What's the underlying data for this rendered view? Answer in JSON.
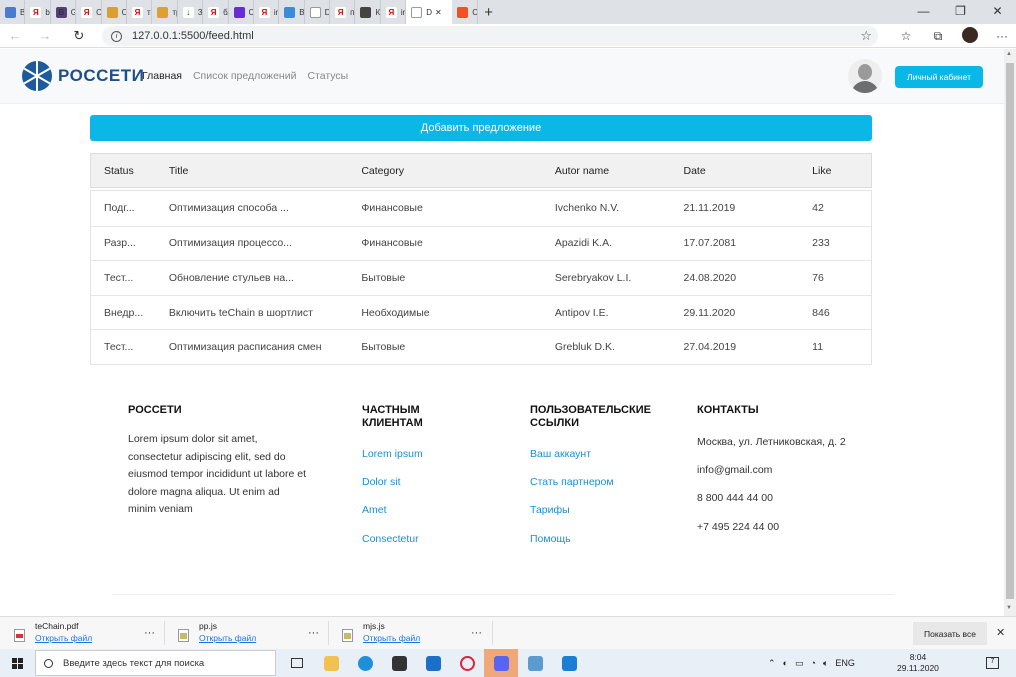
{
  "browser": {
    "tabs": [
      {
        "label": "Все п",
        "icon": "tab-page-icon",
        "color": "#4a7bd1",
        "glyph": ""
      },
      {
        "label": "boots",
        "icon": "yandex-icon",
        "color": "#ffffff",
        "glyph": "Я"
      },
      {
        "label": "Grid s",
        "icon": "bootstrap-icon",
        "color": "#563d7c",
        "glyph": "B"
      },
      {
        "label": "Опти",
        "icon": "yandex-icon",
        "color": "#ffffff",
        "glyph": "Я"
      },
      {
        "label": "Опти",
        "icon": "page-icon",
        "color": "#d9a030",
        "glyph": ""
      },
      {
        "label": "транс",
        "icon": "yandex-icon",
        "color": "#ffffff",
        "glyph": "Я"
      },
      {
        "label": "транс",
        "icon": "image-icon",
        "color": "#e0a030",
        "glyph": ""
      },
      {
        "label": "Загру",
        "icon": "download-icon",
        "color": "#ffffff",
        "glyph": "↓"
      },
      {
        "label": "блок",
        "icon": "yandex-icon",
        "color": "#ffffff",
        "glyph": "Я"
      },
      {
        "label": "Секц",
        "icon": "purple-icon",
        "color": "#6a2bd9",
        "glyph": ""
      },
      {
        "label": "image",
        "icon": "yandex-icon",
        "color": "#ffffff",
        "glyph": "Я"
      },
      {
        "label": "Выра",
        "icon": "color-icon",
        "color": "#3b8bd9",
        "glyph": ""
      },
      {
        "label": "Docu",
        "icon": "doc-icon",
        "color": "#ffffff",
        "glyph": ""
      },
      {
        "label": "подк",
        "icon": "yandex-icon",
        "color": "#ffffff",
        "glyph": "Я"
      },
      {
        "label": "Как п",
        "icon": "dark-icon",
        "color": "#444444",
        "glyph": ""
      },
      {
        "label": "impo",
        "icon": "yandex-icon",
        "color": "#ffffff",
        "glyph": "Я"
      },
      {
        "label": "D",
        "icon": "doc-icon",
        "color": "#ffffff",
        "glyph": "",
        "active": true
      },
      {
        "label": "Спра",
        "icon": "microsoft-icon",
        "color": "#f25022",
        "glyph": ""
      }
    ],
    "url": "127.0.0.1:5500/feed.html"
  },
  "header": {
    "logo_text": "РОССЕТИ",
    "nav": [
      "Главная",
      "Список предложений",
      "Статусы"
    ],
    "cabinet_label": "Личный кабинет"
  },
  "add_button_label": "Добавить предложение",
  "table": {
    "columns": [
      "Status",
      "Title",
      "Category",
      "Autor name",
      "Date",
      "Like"
    ],
    "rows": [
      [
        "Подг...",
        "Оптимизация способа ...",
        "Финансовые",
        "Ivchenko N.V.",
        "21.11.2019",
        "42"
      ],
      [
        "Разр...",
        "Оптимизация процессо...",
        "Финансовые",
        "Apazidi K.A.",
        "17.07.2081",
        "233"
      ],
      [
        "Тест...",
        "Обновление стульев на...",
        "Бытовые",
        "Serebryakov L.I.",
        "24.08.2020",
        "76"
      ],
      [
        "Внедр...",
        "Включить teChain в шортлист",
        "Необходимые",
        "Antipov I.E.",
        "29.11.2020",
        "846"
      ],
      [
        "Тест...",
        "Оптимизация расписания смен",
        "Бытовые",
        "Grebluk D.K.",
        "27.04.2019",
        "11"
      ]
    ]
  },
  "footer": {
    "about_title": "РОССЕТИ",
    "about_text": "Lorem ipsum dolor sit amet, consectetur adipiscing elit, sed do eiusmod tempor incididunt ut labore et dolore magna aliqua. Ut enim ad minim veniam",
    "private_title": "ЧАСТНЫМ КЛИЕНТАМ",
    "private_links": [
      "Lorem ipsum",
      "Dolor sit",
      "Amet",
      "Consectetur"
    ],
    "user_title": "ПОЛЬЗОВАТЕЛЬСКИЕ ССЫЛКИ",
    "user_links": [
      "Ваш аккаунт",
      "Стать партнером",
      "Тарифы",
      "Помощь"
    ],
    "contacts_title": "КОНТАКТЫ",
    "contacts": [
      "Москва, ул. Летниковская, д. 2",
      "info@gmail.com",
      "8 800 444 44 00",
      "+7 495 224 44 00"
    ]
  },
  "downloads": {
    "items": [
      {
        "name": "teChain.pdf",
        "action": "Открыть файл"
      },
      {
        "name": "pp.js",
        "action": "Открыть файл"
      },
      {
        "name": "mjs.js",
        "action": "Открыть файл"
      }
    ],
    "show_all": "Показать все"
  },
  "taskbar": {
    "search_placeholder": "Введите здесь текст для поиска",
    "lang": "ENG",
    "time": "8:04",
    "date": "29.11.2020",
    "notif_count": "7"
  },
  "colors": {
    "accent": "#0bb7e6",
    "brand": "#1d4f8f",
    "link": "#1a8fd6"
  }
}
